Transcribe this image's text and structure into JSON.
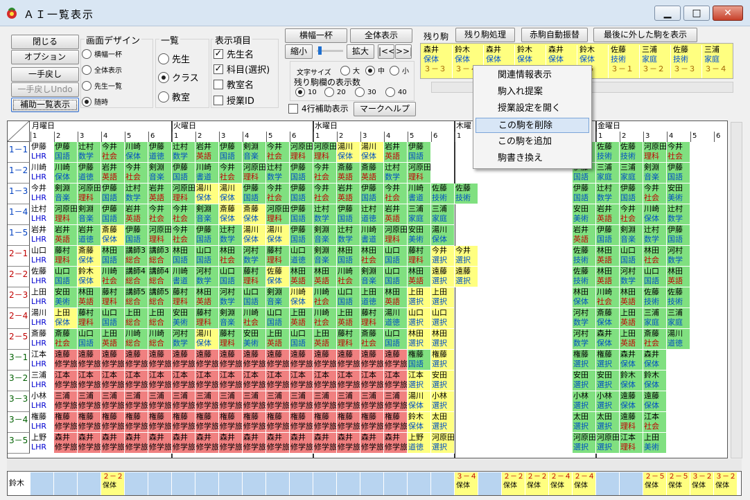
{
  "window": {
    "title": "ＡＩ一覧表示",
    "min": "▁",
    "max": "□",
    "close": "✕"
  },
  "buttons": {
    "close": "閉じる",
    "option": "オプション",
    "undo": "一手戻し",
    "undo2": "一手戻しUndo",
    "assist": "補助一覧表示",
    "width_one": "横幅一杯",
    "show_all": "全体表示",
    "shrink": "縮小",
    "expand": "拡大",
    "first": "|<<",
    "last": ">>|",
    "mark_help": "マークヘルプ",
    "remain_proc": "残り駒処理",
    "red_auto": "赤駒自動振替",
    "show_last": "最後に外した駒を表示"
  },
  "design": {
    "title": "画面デザイン",
    "options": [
      "横幅一杯",
      "全体表示",
      "先生一覧",
      "随時"
    ],
    "selected": 3
  },
  "list": {
    "title": "一覧",
    "options": [
      "先生",
      "クラス",
      "教室"
    ],
    "selected": 1
  },
  "display": {
    "title": "表示項目",
    "items": [
      {
        "label": "先生名",
        "checked": true
      },
      {
        "label": "科目(選択)",
        "checked": true
      },
      {
        "label": "教室名",
        "checked": false
      },
      {
        "label": "授業ID",
        "checked": false
      }
    ]
  },
  "fontsize": {
    "label": "文字サイズ",
    "options": [
      "大",
      "中",
      "小"
    ],
    "selected": 1
  },
  "remain_count": {
    "label": "残り駒欄の表示数",
    "options": [
      "10",
      "20",
      "30",
      "40"
    ],
    "selected": 0
  },
  "four_row": {
    "label": "4行補助表示",
    "checked": false
  },
  "remain": {
    "label": "残り駒",
    "items": [
      {
        "t": "森井",
        "s": "保体",
        "c": "３－３"
      },
      {
        "t": "鈴木",
        "s": "保体",
        "c": "３－４"
      },
      {
        "t": "森井",
        "s": "保体",
        "c": ""
      },
      {
        "t": "鈴木",
        "s": "保体",
        "c": ""
      },
      {
        "t": "森井",
        "s": "保体",
        "c": ""
      },
      {
        "t": "鈴木",
        "s": "保体",
        "c": "－５"
      },
      {
        "t": "佐藤",
        "s": "技術",
        "c": "３－１"
      },
      {
        "t": "三浦",
        "s": "家庭",
        "c": "３－２"
      },
      {
        "t": "佐藤",
        "s": "技術",
        "c": "３－３"
      },
      {
        "t": "三浦",
        "s": "家庭",
        "c": "３－４"
      }
    ]
  },
  "context_menu": {
    "items": [
      "関連情報表示",
      "駒入れ提案",
      "授業設定を開く",
      "この駒を削除",
      "この駒を追加",
      "駒書き換え"
    ],
    "highlighted": 3
  },
  "days": [
    "月曜日",
    "火曜日",
    "水曜日",
    "木曜日",
    "金曜日"
  ],
  "rows": [
    "1－1",
    "1－2",
    "1－3",
    "1－4",
    "1－5",
    "2－1",
    "2－2",
    "2－3",
    "2－4",
    "2－5",
    "3－1",
    "3－2",
    "3－3",
    "3－4",
    "3－5"
  ],
  "grid": [
    [
      "伊藤/LHR/w",
      "伊藤/国語/g",
      "辻村/数学/g",
      "今井/社会/g",
      "川崎/保体/g",
      "伊藤/道徳/g",
      "辻村/数学/g",
      "岩井/英語/g",
      "伊藤/国語/g",
      "剣淵/音楽/g",
      "今井/社会/g",
      "河原田/理科/g",
      "河原田/理科/g",
      "湯川/保体/y",
      "湯川/保体/y",
      "岩井/英語/g",
      "伊藤/国語/g",
      "",
      "",
      "",
      "",
      "",
      "",
      "辻村/数学/g",
      "佐藤/技術/g",
      "佐藤/技術/g",
      "河原田/理科/g",
      "今井/社会/g"
    ],
    [
      "川崎/LHR/w",
      "川崎/保体/g",
      "伊藤/道徳/g",
      "岩井/英語/g",
      "今井/社会/g",
      "剣淵/音楽/g",
      "伊藤/国語/g",
      "川崎/書道/g",
      "今井/社会/g",
      "河原田/理科/g",
      "辻村/数学/g",
      "伊藤/国語/g",
      "今井/社会/g",
      "斎藤/英語/g",
      "斎藤/英語/g",
      "辻村/数学/g",
      "河原田/理科/g",
      "",
      "",
      "",
      "",
      "",
      "",
      "伊藤/国語/g",
      "三浦/家庭/g",
      "三浦/家庭/g",
      "剣淵/音楽/g",
      "伊藤/国語/g"
    ],
    [
      "今井/LHR/w",
      "剣淵/音楽/g",
      "河原田/理科/g",
      "伊藤/国語/g",
      "辻村/数学/g",
      "岩井/英語/g",
      "河原田/理科/g",
      "湯川/保体/y",
      "湯川/保体/y",
      "伊藤/国語/g",
      "今井/社会/g",
      "伊藤/国語/g",
      "今井/社会/g",
      "岩井/英語/g",
      "伊藤/国語/g",
      "今井/社会/g",
      "川崎/書道/g",
      "佐藤/技術/g",
      "佐藤/技術/g",
      "",
      "",
      "",
      "",
      "伊藤/国語/g",
      "辻村/数学/g",
      "伊藤/国語/g",
      "今井/社会/g",
      "安田/美術/g"
    ],
    [
      "辻村/LHR/w",
      "河原田/理科/g",
      "剣淵/音楽/g",
      "伊藤/国語/g",
      "岩井/英語/g",
      "今井/社会/g",
      "今井/社会/g",
      "剣淵/音楽/g",
      "斎藤/保体/y",
      "斎藤/保体/y",
      "河原田/理科/g",
      "伊藤/国語/g",
      "辻村/数学/g",
      "伊藤/国語/g",
      "辻村/道徳/g",
      "岩井/英語/g",
      "三浦/家庭/g",
      "三浦/家庭/g",
      "",
      "",
      "",
      "",
      "",
      "安田/美術/g",
      "岩井/英語/g",
      "今井/社会/g",
      "川崎/保体/g",
      "辻村/数学/g"
    ],
    [
      "岩井/LHR/w",
      "岩井/英語/g",
      "岩井/道徳/g",
      "斎藤/保体/y",
      "伊藤/国語/g",
      "河原田/理科/g",
      "今井/社会/g",
      "伊藤/国語/g",
      "辻村/数学/g",
      "湯川/保体/y",
      "湯川/保体/y",
      "伊藤/国語/g",
      "剣淵/音楽/g",
      "辻村/数学/g",
      "川崎/書道/g",
      "河原田/理科/g",
      "安田/美術/g",
      "湯川/保体/g",
      "",
      "",
      "",
      "",
      "",
      "岩井/英語/g",
      "伊藤/国語/g",
      "剣淵/音楽/g",
      "辻村/数学/g",
      "伊藤/国語/g"
    ],
    [
      "山口/LHR/w",
      "藤村/理科/g",
      "斎藤/保体/y",
      "林田/国語/g",
      "講師3/総合/g",
      "講師3/総合/g",
      "林田/国語/g",
      "山口/国語/g",
      "林田/社会/g",
      "河村/数学/g",
      "藤村/理科/g",
      "山口/道徳/g",
      "剣淵/音楽/g",
      "林田/国語/g",
      "林田/社会/g",
      "山口/国語/g",
      "藤村/理科/g",
      "今井/選択/y",
      "今井/選択/y",
      "",
      "",
      "",
      "",
      "佐藤/技術/g",
      "林田/英語/g",
      "山口/国語/g",
      "林田/社会/g",
      "河村/数学/g"
    ],
    [
      "佐藤/LHR/w",
      "山口/国語/g",
      "鈴木/保体/y",
      "川崎/社会/g",
      "講師4/総合/g",
      "講師4/総合/g",
      "川崎/書道/g",
      "河村/数学/g",
      "山口/国語/g",
      "藤村/理科/g",
      "佐藤/保体/y",
      "林田/英語/g",
      "林田/英語/g",
      "川崎/社会/g",
      "剣淵/音楽/g",
      "山口/国語/g",
      "林田/英語/g",
      "遠藤/選択/y",
      "遠藤/選択/y",
      "",
      "",
      "",
      "",
      "佐藤/技術/g",
      "林田/英語/g",
      "河村/数学/g",
      "山口/国語/g",
      "林田/英語/g"
    ],
    [
      "上田/LHR/w",
      "安田/美術/g",
      "林田/英語/g",
      "藤村/理科/g",
      "講師5/総合/g",
      "講師5/総合/g",
      "藤村/理科/g",
      "林田/英語/g",
      "河村/数学/g",
      "山口/国語/g",
      "剣淵/音楽/g",
      "川崎/保体/y",
      "川崎/社会/g",
      "山口/国語/g",
      "上田/道徳/g",
      "林田/英語/g",
      "上田/選択/y",
      "上田/選択/y",
      "",
      "",
      "",
      "",
      "",
      "林田/保体/g",
      "川崎/社会/g",
      "林田/英語/g",
      "佐藤/技術/g",
      "佐藤/技術/g"
    ],
    [
      "湯川/LHR/w",
      "上田/保体/y",
      "藤村/理科/g",
      "山口/国語/g",
      "上田/総合/g",
      "上田/総合/g",
      "安田/美術/g",
      "藤村/理科/g",
      "剣淵/音楽/g",
      "川崎/社会/g",
      "山口/国語/g",
      "上田/英語/g",
      "川崎/社会/g",
      "上田/英語/g",
      "藤村/理科/g",
      "湯川/道徳/g",
      "山口/選択/y",
      "山口/選択/y",
      "",
      "",
      "",
      "",
      "",
      "河村/数学/g",
      "斎藤/保体/g",
      "上田/英語/g",
      "三浦/家庭/g",
      "三浦/家庭/g"
    ],
    [
      "斎藤/LHR/w",
      "斎藤/社会/g",
      "山口/国語/g",
      "上田/英語/g",
      "川崎/総合/g",
      "川崎/総合/g",
      "河村/数学/g",
      "湯川/保体/y",
      "藤村/理科/g",
      "安田/美術/g",
      "上田/英語/g",
      "山口/国語/g",
      "上田/英語/g",
      "藤村/理科/g",
      "斎藤/社会/g",
      "山口/国語/g",
      "林田/選択/y",
      "林田/選択/y",
      "",
      "",
      "",
      "",
      "",
      "河村/数学/g",
      "森井/保体/g",
      "上田/英語/g",
      "斎藤/社会/g",
      "湯川/道徳/g"
    ],
    [
      "江本/LHR/w",
      "遠藤/修学旅/r",
      "遠藤/修学旅/r",
      "遠藤/修学旅/r",
      "遠藤/修学旅/r",
      "遠藤/修学旅/r",
      "遠藤/修学旅/r",
      "遠藤/修学旅/r",
      "遠藤/修学旅/r",
      "遠藤/修学旅/r",
      "遠藤/修学旅/r",
      "遠藤/修学旅/r",
      "遠藤/修学旅/r",
      "遠藤/修学旅/r",
      "遠藤/修学旅/r",
      "遠藤/修学旅/r",
      "権藤/国語/g",
      "権藤/選択/y",
      "",
      "",
      "",
      "",
      "",
      "権藤/選択/g",
      "権藤/選択/g",
      "森井/保体/g",
      "森井/保体/g",
      ""
    ],
    [
      "三浦/LHR/w",
      "江本/修学旅/r",
      "江本/修学旅/r",
      "江本/修学旅/r",
      "江本/修学旅/r",
      "江本/修学旅/r",
      "江本/修学旅/r",
      "江本/修学旅/r",
      "江本/修学旅/r",
      "江本/修学旅/r",
      "江本/修学旅/r",
      "江本/修学旅/r",
      "江本/修学旅/r",
      "江本/修学旅/r",
      "江本/修学旅/r",
      "江本/修学旅/r",
      "江本/選択/y",
      "安田/選択/y",
      "",
      "",
      "",
      "",
      "",
      "安田/選択/g",
      "安田/選択/g",
      "鈴木/保体/g",
      "鈴木/保体/g",
      ""
    ],
    [
      "小林/LHR/w",
      "三浦/修学旅/r",
      "三浦/修学旅/r",
      "三浦/修学旅/r",
      "三浦/修学旅/r",
      "三浦/修学旅/r",
      "三浦/修学旅/r",
      "三浦/修学旅/r",
      "三浦/修学旅/r",
      "三浦/修学旅/r",
      "三浦/修学旅/r",
      "三浦/修学旅/r",
      "三浦/修学旅/r",
      "三浦/修学旅/r",
      "三浦/修学旅/r",
      "三浦/修学旅/r",
      "湯川/保体/y",
      "小林/選択/y",
      "",
      "",
      "",
      "",
      "",
      "小林/選択/g",
      "小林/選択/g",
      "遠藤/保体/g",
      "遠藤/保体/g",
      ""
    ],
    [
      "権藤/LHR/w",
      "権藤/修学旅/r",
      "権藤/修学旅/r",
      "権藤/修学旅/r",
      "権藤/修学旅/r",
      "権藤/修学旅/r",
      "権藤/修学旅/r",
      "権藤/修学旅/r",
      "権藤/修学旅/r",
      "権藤/修学旅/r",
      "権藤/修学旅/r",
      "権藤/修学旅/r",
      "権藤/修学旅/r",
      "権藤/修学旅/r",
      "権藤/修学旅/r",
      "権藤/修学旅/r",
      "鈴木/保体/y",
      "太田/選択/y",
      "",
      "",
      "",
      "",
      "",
      "太田/選択/g",
      "太田/選択/g",
      "遠藤/理科/g",
      "江本/社会/g",
      ""
    ],
    [
      "上野/LHR/w",
      "森井/修学旅/r",
      "森井/修学旅/r",
      "森井/修学旅/r",
      "森井/修学旅/r",
      "森井/修学旅/r",
      "森井/修学旅/r",
      "森井/修学旅/r",
      "森井/修学旅/r",
      "森井/修学旅/r",
      "森井/修学旅/r",
      "森井/修学旅/r",
      "森井/修学旅/r",
      "森井/修学旅/r",
      "森井/修学旅/r",
      "森井/修学旅/r",
      "上野/道徳/y",
      "河原田/選択/y",
      "",
      "",
      "",
      "",
      "",
      "河原田/選択/g",
      "河原田/選択/g",
      "江本/理科/g",
      "上田/美術/g",
      ""
    ]
  ],
  "bottom": {
    "teacher": "鈴木",
    "items": [
      {
        "slot": 3,
        "c": "２－２",
        "s": "保体"
      },
      {
        "slot": 18,
        "c": "３－４",
        "s": "保体"
      },
      {
        "slot": 20,
        "c": "２－２",
        "s": "保体"
      },
      {
        "slot": 21,
        "c": "２－２",
        "s": "保体"
      },
      {
        "slot": 22,
        "c": "２－４",
        "s": "保体"
      },
      {
        "slot": 23,
        "c": "２－４",
        "s": "保体"
      },
      {
        "slot": 26,
        "c": "２－５",
        "s": "保体"
      },
      {
        "slot": 27,
        "c": "２－５",
        "s": "保体"
      },
      {
        "slot": 28,
        "c": "３－２",
        "s": "保体"
      },
      {
        "slot": 29,
        "c": "３－２",
        "s": "保体"
      }
    ]
  }
}
